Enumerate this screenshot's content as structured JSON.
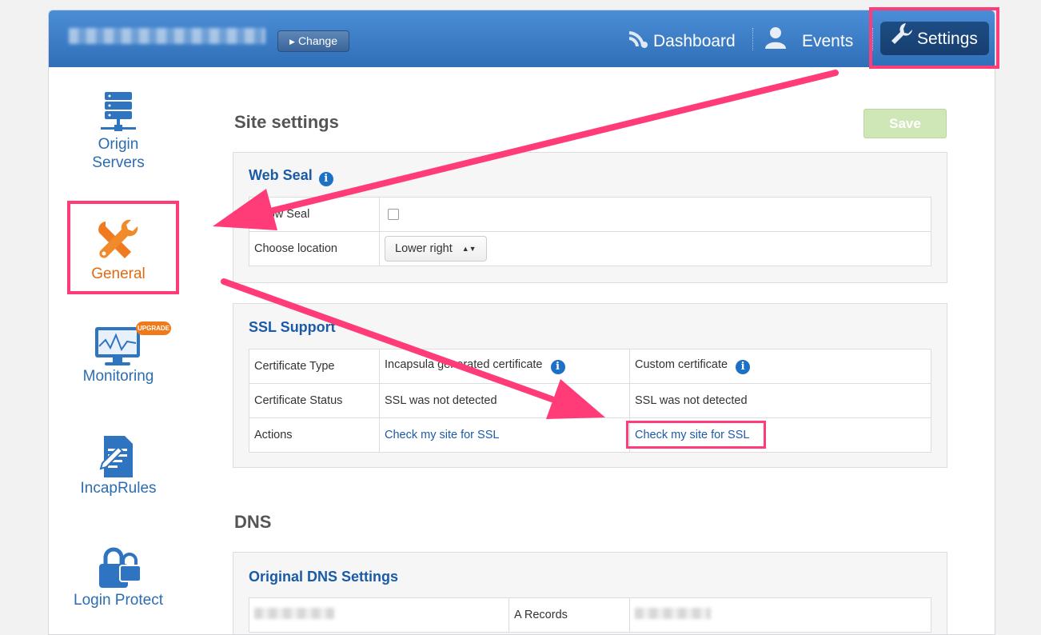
{
  "header": {
    "change_label": "Change",
    "nav": {
      "dashboard": "Dashboard",
      "events": "Events",
      "settings": "Settings"
    }
  },
  "sidebar": {
    "items": [
      {
        "label_line1": "Origin",
        "label_line2": "Servers",
        "icon": "server-icon"
      },
      {
        "label": "General",
        "icon": "tools-icon"
      },
      {
        "label": "Monitoring",
        "icon": "monitor-icon",
        "badge": "UPGRADE"
      },
      {
        "label": "IncapRules",
        "icon": "document-edit-icon"
      },
      {
        "label": "Login Protect",
        "icon": "lock-icon"
      }
    ]
  },
  "main": {
    "site_settings_title": "Site settings",
    "save_label": "Save",
    "web_seal": {
      "title": "Web Seal",
      "rows": [
        {
          "label": "Show Seal"
        },
        {
          "label": "Choose location",
          "value": "Lower right"
        }
      ]
    },
    "ssl": {
      "title": "SSL Support",
      "rows": [
        {
          "label": "Certificate Type",
          "col1": "Incapsula generated certificate",
          "col2": "Custom certificate"
        },
        {
          "label": "Certificate Status",
          "col1": "SSL was not detected",
          "col2": "SSL was not detected"
        },
        {
          "label": "Actions",
          "col1": "Check my site for SSL",
          "col2": "Check my site for SSL"
        }
      ]
    },
    "dns_title": "DNS",
    "dns": {
      "title": "Original DNS Settings",
      "a_records_label": "A Records"
    }
  },
  "colors": {
    "header_blue": "#2f6fb8",
    "accent_pink": "#ff3b78",
    "link_blue": "#1d5aa5",
    "general_orange": "#e06a13"
  }
}
